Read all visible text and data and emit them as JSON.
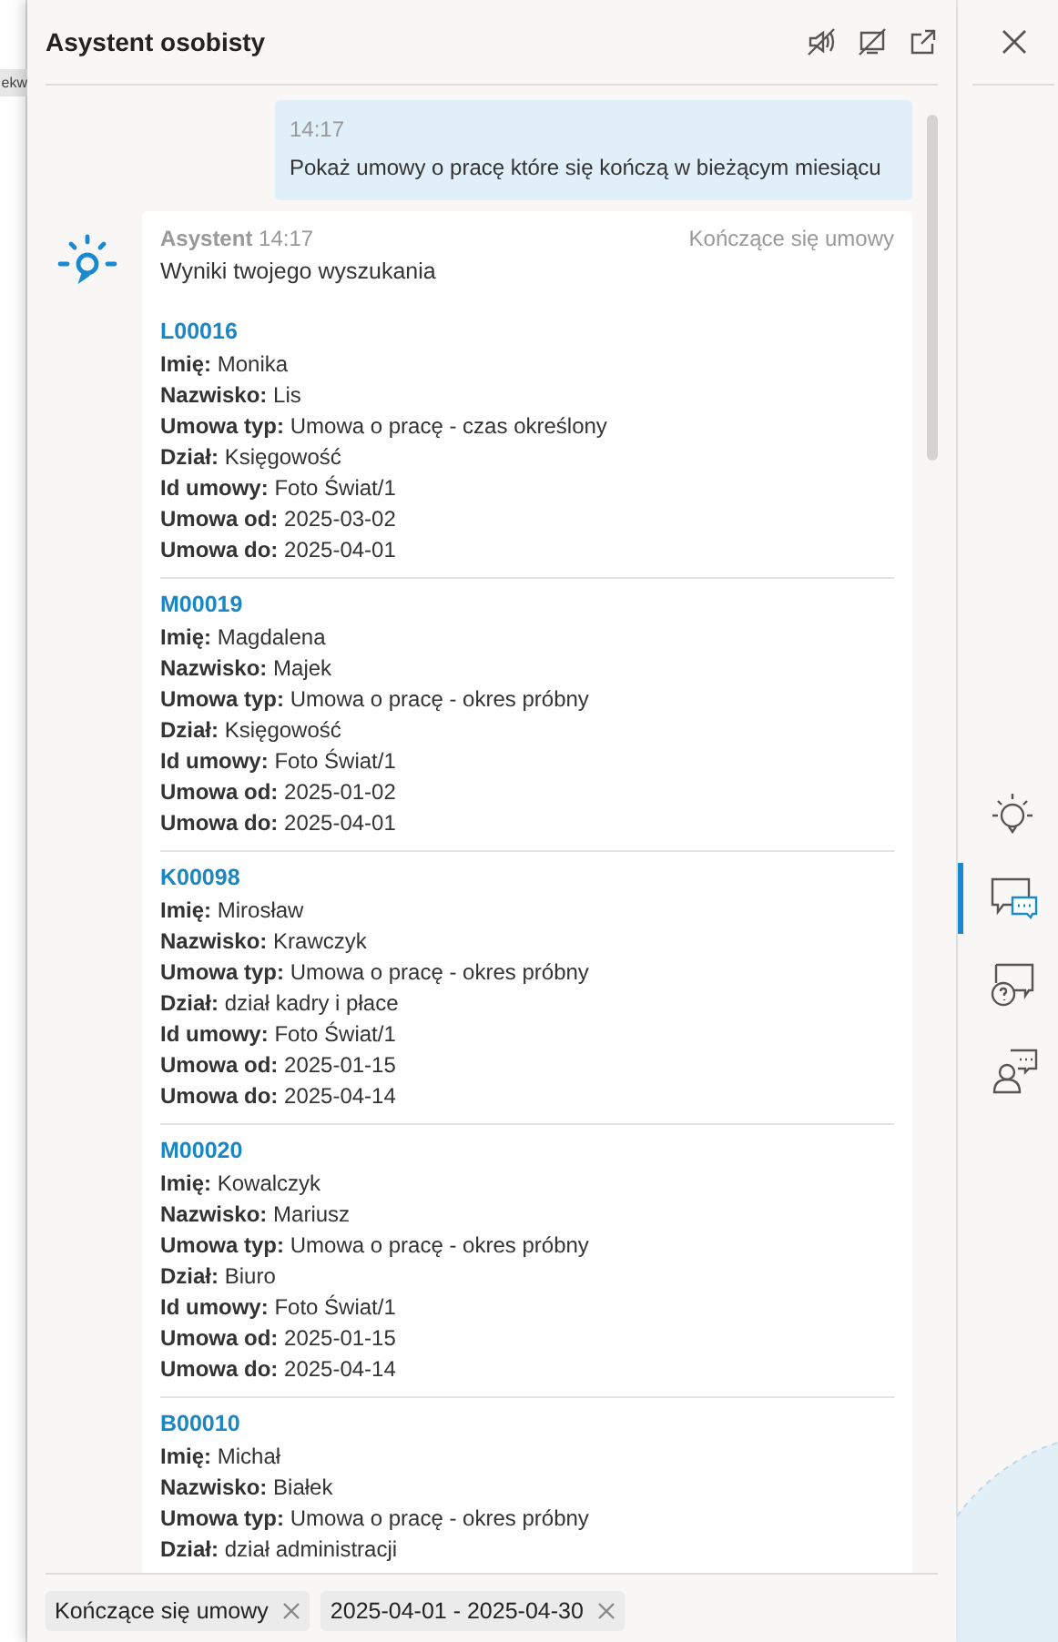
{
  "background_text": "ekw",
  "panel": {
    "title": "Asystent osobisty"
  },
  "messages": [
    {
      "kind": "user",
      "time": "14:17",
      "text": "Pokaż umowy o pracę które się kończą w bieżącym miesiącu"
    },
    {
      "kind": "assistant",
      "sender": "Asystent",
      "time": "14:17",
      "topic": "Kończące się umowy",
      "intro": "Wyniki twojego wyszukania",
      "records": [
        {
          "id": "L00016",
          "fields": [
            {
              "label": "Imię:",
              "value": "Monika"
            },
            {
              "label": "Nazwisko:",
              "value": "Lis"
            },
            {
              "label": "Umowa typ:",
              "value": "Umowa o pracę - czas określony"
            },
            {
              "label": "Dział:",
              "value": "Księgowość"
            },
            {
              "label": "Id umowy:",
              "value": "Foto Świat/1"
            },
            {
              "label": "Umowa od:",
              "value": "2025-03-02"
            },
            {
              "label": "Umowa do:",
              "value": "2025-04-01"
            }
          ]
        },
        {
          "id": "M00019",
          "fields": [
            {
              "label": "Imię:",
              "value": "Magdalena"
            },
            {
              "label": "Nazwisko:",
              "value": "Majek"
            },
            {
              "label": "Umowa typ:",
              "value": "Umowa o pracę - okres próbny"
            },
            {
              "label": "Dział:",
              "value": "Księgowość"
            },
            {
              "label": "Id umowy:",
              "value": "Foto Świat/1"
            },
            {
              "label": "Umowa od:",
              "value": "2025-01-02"
            },
            {
              "label": "Umowa do:",
              "value": "2025-04-01"
            }
          ]
        },
        {
          "id": "K00098",
          "fields": [
            {
              "label": "Imię:",
              "value": "Mirosław"
            },
            {
              "label": "Nazwisko:",
              "value": "Krawczyk"
            },
            {
              "label": "Umowa typ:",
              "value": "Umowa o pracę - okres próbny"
            },
            {
              "label": "Dział:",
              "value": "dział kadry i płace"
            },
            {
              "label": "Id umowy:",
              "value": "Foto Świat/1"
            },
            {
              "label": "Umowa od:",
              "value": "2025-01-15"
            },
            {
              "label": "Umowa do:",
              "value": "2025-04-14"
            }
          ]
        },
        {
          "id": "M00020",
          "fields": [
            {
              "label": "Imię:",
              "value": "Kowalczyk"
            },
            {
              "label": "Nazwisko:",
              "value": "Mariusz"
            },
            {
              "label": "Umowa typ:",
              "value": "Umowa o pracę - okres próbny"
            },
            {
              "label": "Dział:",
              "value": "Biuro"
            },
            {
              "label": "Id umowy:",
              "value": "Foto Świat/1"
            },
            {
              "label": "Umowa od:",
              "value": "2025-01-15"
            },
            {
              "label": "Umowa do:",
              "value": "2025-04-14"
            }
          ]
        },
        {
          "id": "B00010",
          "fields": [
            {
              "label": "Imię:",
              "value": "Michał"
            },
            {
              "label": "Nazwisko:",
              "value": "Białek"
            },
            {
              "label": "Umowa typ:",
              "value": "Umowa o pracę - okres próbny"
            },
            {
              "label": "Dział:",
              "value": "dział administracji"
            }
          ]
        }
      ]
    }
  ],
  "filters": [
    {
      "label": "Kończące się umowy"
    },
    {
      "label": "2025-04-01 - 2025-04-30"
    }
  ],
  "sidebar": [
    {
      "kind": "ideas",
      "selected": false
    },
    {
      "kind": "chat",
      "selected": true
    },
    {
      "kind": "help",
      "selected": false
    },
    {
      "kind": "contact",
      "selected": false
    }
  ]
}
